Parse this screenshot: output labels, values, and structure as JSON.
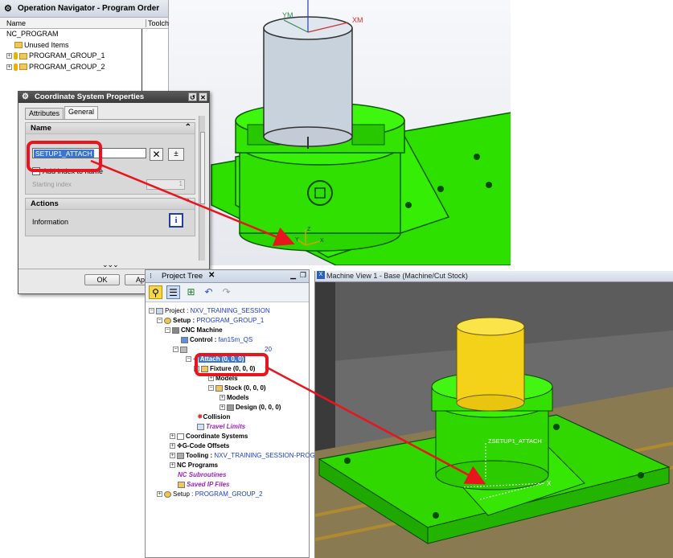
{
  "nx": {
    "axis_ym": "YM",
    "axis_xm": "XM",
    "axis_z": "Z",
    "axis_y": "Y",
    "axis_x": "X"
  },
  "op_nav": {
    "title": "Operation Navigator - Program Order",
    "col_name": "Name",
    "col_tool": "Toolch",
    "rows": [
      {
        "label": "NC_PROGRAM"
      },
      {
        "label": "Unused Items"
      },
      {
        "label": "PROGRAM_GROUP_1"
      },
      {
        "label": "PROGRAM_GROUP_2"
      }
    ]
  },
  "csp": {
    "title": "Coordinate System Properties",
    "tab_attributes": "Attributes",
    "tab_general": "General",
    "name_section": "Name",
    "name_value": "SETUP1_ATTACH",
    "add_index_label": "Add index to name",
    "starting_index_label": "Starting index",
    "starting_index_value": "1",
    "actions_section": "Actions",
    "information_label": "Information",
    "ok_button": "OK",
    "apply_button": "App",
    "more_indicator": "⌄⌄⌄"
  },
  "project_tree": {
    "title": "Project Tree",
    "rows": [
      {
        "indent": 0,
        "label": "Project : ",
        "value": "NXV_TRAINING_SESSION"
      },
      {
        "indent": 1,
        "label": "Setup : ",
        "value": "PROGRAM_GROUP_1"
      },
      {
        "indent": 2,
        "label": "CNC Machine",
        "value": ""
      },
      {
        "indent": 3,
        "label": "Control : ",
        "value": "fan15m_QS"
      },
      {
        "indent": 3,
        "label": "",
        "value": "20"
      },
      {
        "indent": 4,
        "label": "Attach (0, 0, 0)",
        "value": "",
        "selected": true
      },
      {
        "indent": 5,
        "label": "Fixture (0, 0, 0)",
        "value": ""
      },
      {
        "indent": 6,
        "label": "Models",
        "value": ""
      },
      {
        "indent": 6,
        "label": "Stock (0, 0, 0)",
        "value": ""
      },
      {
        "indent": 7,
        "label": "Models",
        "value": ""
      },
      {
        "indent": 7,
        "label": "Design (0, 0, 0)",
        "value": ""
      },
      {
        "indent": 4,
        "label": "Collision",
        "value": ""
      },
      {
        "indent": 4,
        "label": "",
        "value": "",
        "purple": "Travel Limits"
      },
      {
        "indent": 2,
        "label": "Coordinate Systems",
        "value": ""
      },
      {
        "indent": 2,
        "label": "G-Code Offsets",
        "value": ""
      },
      {
        "indent": 2,
        "label": "Tooling : ",
        "value": "NXV_TRAINING_SESSION-PROG"
      },
      {
        "indent": 2,
        "label": "NC Programs",
        "value": ""
      },
      {
        "indent": 2,
        "label": "",
        "value": "",
        "purple": "NC Subroutines"
      },
      {
        "indent": 2,
        "label": "",
        "value": "",
        "purple": "Saved IP Files"
      },
      {
        "indent": 1,
        "label": "Setup : ",
        "value": "PROGRAM_GROUP_2"
      }
    ]
  },
  "machine_view": {
    "title": "Machine View 1 - Base (Machine/Cut Stock)",
    "cs_label": "ZSETUP1_ATTACH",
    "axis_x": "X"
  },
  "colors": {
    "highlight_red": "#e8141e",
    "fixture_green": "#2fe000",
    "stock_yellow": "#f6d21b",
    "selection_blue": "#3875d7"
  }
}
